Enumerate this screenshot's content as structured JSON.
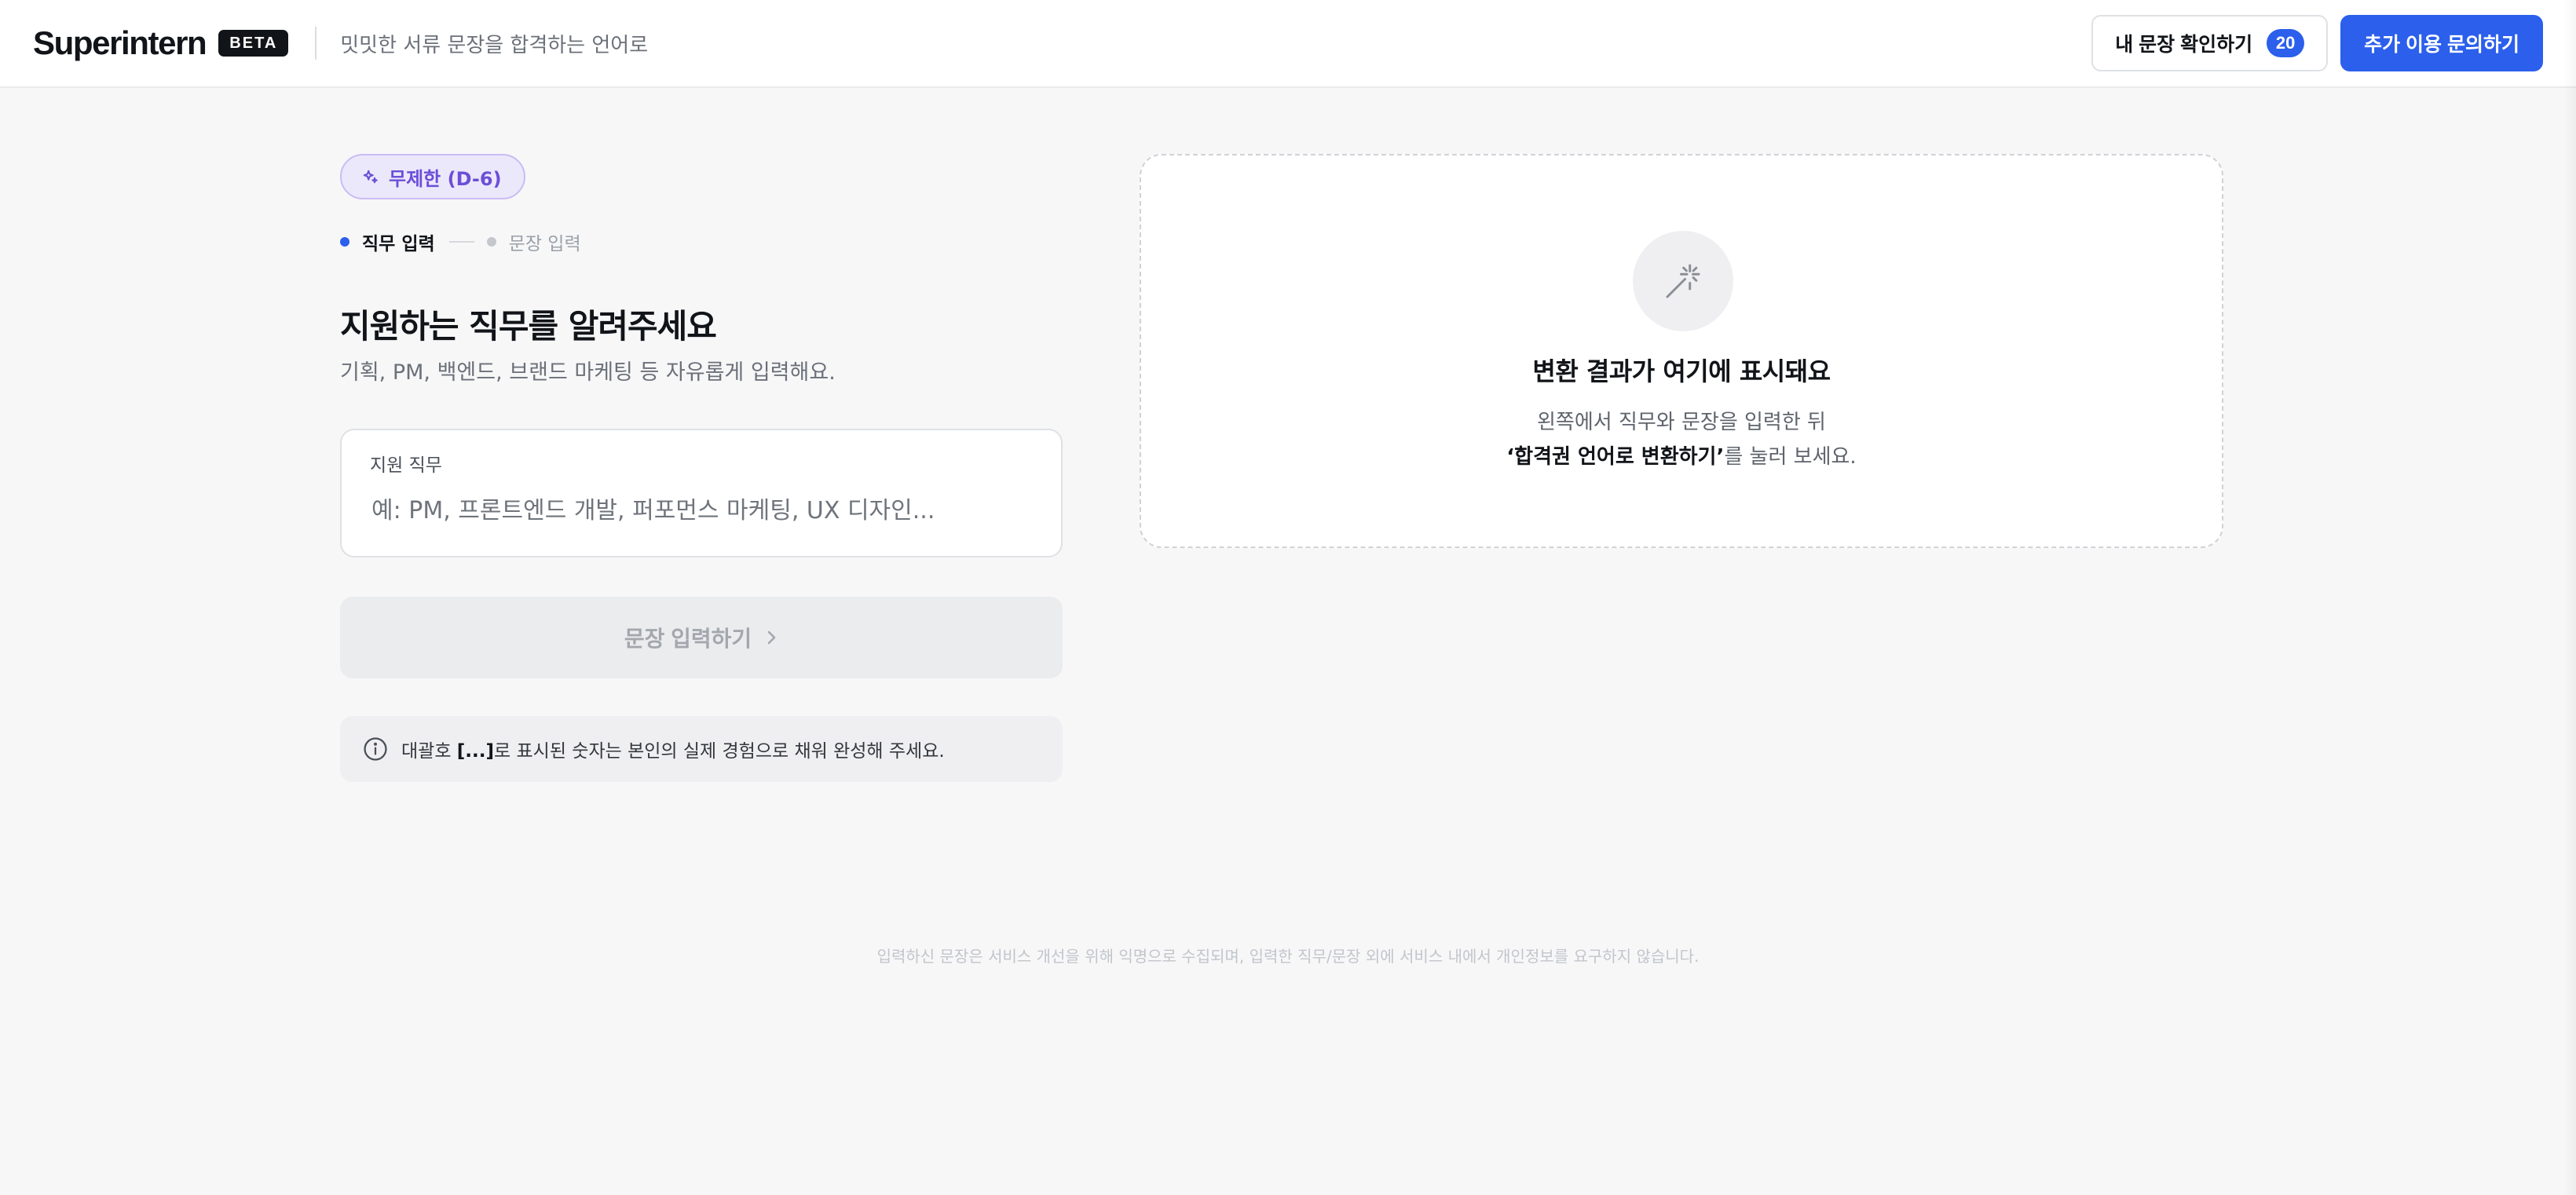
{
  "header": {
    "logo": "Superintern",
    "beta": "BETA",
    "tagline": "밋밋한 서류 문장을 합격하는 언어로",
    "my_sentences_label": "내 문장 확인하기",
    "my_sentences_count": "20",
    "contact_label": "추가 이용 문의하기"
  },
  "plan": {
    "label": "무제한 (D-6)"
  },
  "steps": [
    {
      "label": "직무 입력",
      "active": true
    },
    {
      "label": "문장 입력",
      "active": false
    }
  ],
  "form": {
    "title": "지원하는 직무를 알려주세요",
    "subtitle": "기획, PM, 백엔드, 브랜드 마케팅 등 자유롭게 입력해요.",
    "field_label": "지원 직무",
    "field_value": "",
    "field_placeholder": "예: PM, 프론트엔드 개발, 퍼포먼스 마케팅, UX 디자인...",
    "next_button": "문장 입력하기"
  },
  "notice": {
    "prefix": "대괄호 ",
    "bracket": "[...]",
    "suffix": "로 표시된 숫자는 본인의 실제 경험으로 채워 완성해 주세요."
  },
  "result": {
    "title": "변환 결과가 여기에 표시돼요",
    "line1": "왼쪽에서 직무와 문장을 입력한 뒤",
    "line2_bold": "‘합격권 언어로 변환하기’",
    "line2_rest": "를 눌러 보세요."
  },
  "footer": {
    "privacy_note": "입력하신 문장은 서비스 개선을 위해 익명으로 수집되며, 입력한 직무/문장 외에 서비스 내에서 개인정보를 요구하지 않습니다."
  },
  "colors": {
    "accent": "#2b5fec",
    "plan_purple": "#6a4fd8",
    "background": "#f7f7f8"
  },
  "icons": {
    "plan": "sparkle-icon",
    "next": "chevron-right-icon",
    "notice": "info-icon",
    "result": "magic-wand-icon"
  }
}
